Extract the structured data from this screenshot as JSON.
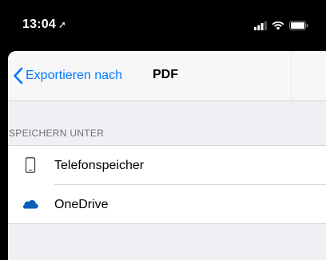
{
  "status_bar": {
    "time": "13:04",
    "location_icon": "location-arrow-icon",
    "signal_icon": "cellular-signal-icon",
    "wifi_icon": "wifi-icon",
    "battery_icon": "battery-icon"
  },
  "nav": {
    "back_icon": "chevron-left-icon",
    "back_label": "Exportieren nach",
    "title": "PDF"
  },
  "section": {
    "header": "SPEICHERN UNTER",
    "items": [
      {
        "label": "Telefonspeicher",
        "icon": "phone-icon"
      },
      {
        "label": "OneDrive",
        "icon": "cloud-icon"
      }
    ]
  },
  "colors": {
    "accent": "#007aff",
    "onedrive": "#0a5eb8",
    "background": "#efeff4"
  }
}
